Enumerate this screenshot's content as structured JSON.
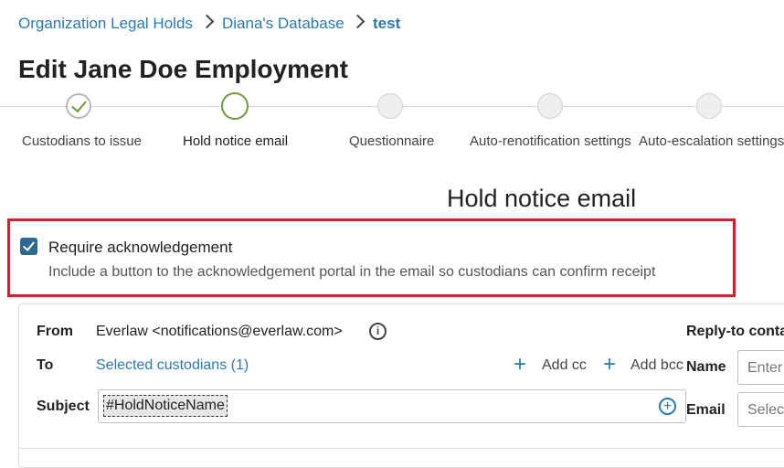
{
  "breadcrumb": {
    "items": [
      "Organization Legal Holds",
      "Diana's Database"
    ],
    "current": "test"
  },
  "page": {
    "title": "Edit Jane Doe Employment"
  },
  "stepper": {
    "steps": [
      {
        "label": "Custodians to issue",
        "state": "done"
      },
      {
        "label": "Hold notice email",
        "state": "active"
      },
      {
        "label": "Questionnaire",
        "state": "pending"
      },
      {
        "label": "Auto-renotification settings",
        "state": "pending"
      },
      {
        "label": "Auto-escalation settings",
        "state": "pending"
      }
    ]
  },
  "section": {
    "heading": "Hold notice email"
  },
  "acknowledgement": {
    "checked": true,
    "label": "Require acknowledgement",
    "description": "Include a button to the acknowledgement portal in the email so custodians can confirm receipt"
  },
  "email": {
    "from_label": "From",
    "from_value": "Everlaw <notifications@everlaw.com>",
    "to_label": "To",
    "to_value": "Selected custodians (1)",
    "add_cc": "Add cc",
    "add_bcc": "Add bcc",
    "subject_label": "Subject",
    "subject_token": "#HoldNoticeName"
  },
  "reply_to": {
    "heading": "Reply-to conta",
    "name_label": "Name",
    "name_placeholder": "Enter",
    "email_label": "Email",
    "email_placeholder": "Select"
  },
  "colors": {
    "accent": "#2a7ab0",
    "highlight_border": "#c8252c",
    "step_active": "#6f9b3a",
    "checkbox": "#2c6a8f"
  },
  "icons": {
    "info": "info-icon",
    "plus": "plus-icon",
    "insert": "circle-plus-icon",
    "chevron": "chevron-right-icon",
    "check": "check-icon"
  }
}
